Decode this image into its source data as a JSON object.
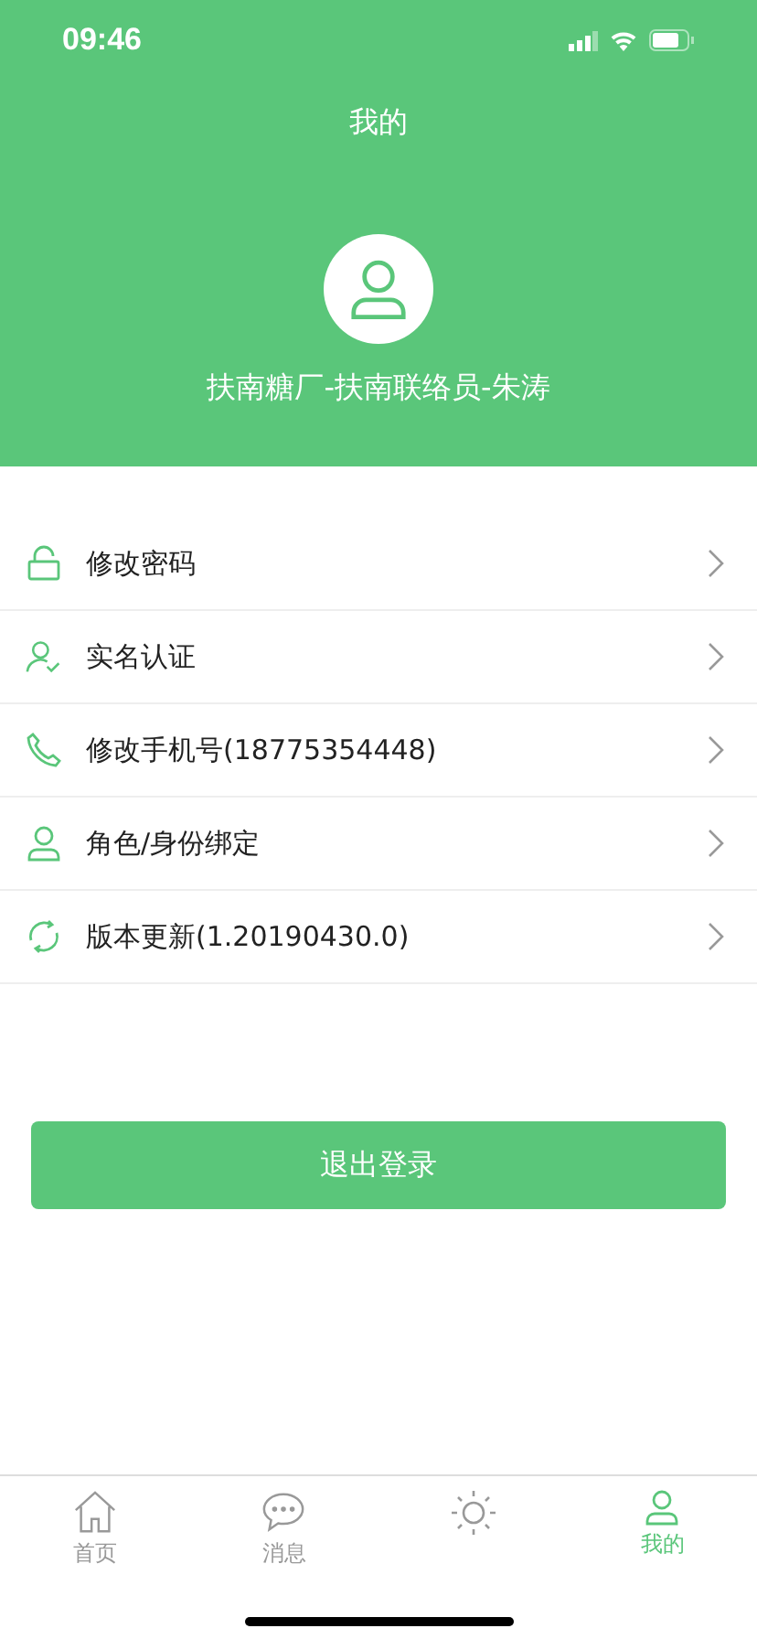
{
  "status_bar": {
    "time": "09:46"
  },
  "header": {
    "title": "我的",
    "user_name": "扶南糖厂-扶南联络员-朱涛"
  },
  "menu": [
    {
      "kind": "lock",
      "label": "修改密码"
    },
    {
      "kind": "verify",
      "label": "实名认证"
    },
    {
      "kind": "phone",
      "label": "修改手机号(18775354448)"
    },
    {
      "kind": "person",
      "label": "角色/身份绑定"
    },
    {
      "kind": "refresh",
      "label": "版本更新(1.20190430.0)"
    }
  ],
  "logout_button": "退出登录",
  "tabs": [
    {
      "kind": "home",
      "label": "首页",
      "selected": false
    },
    {
      "kind": "chat",
      "label": "消息",
      "selected": false
    },
    {
      "kind": "sun",
      "selected": false
    },
    {
      "kind": "person",
      "label": "我的",
      "selected": true
    }
  ]
}
